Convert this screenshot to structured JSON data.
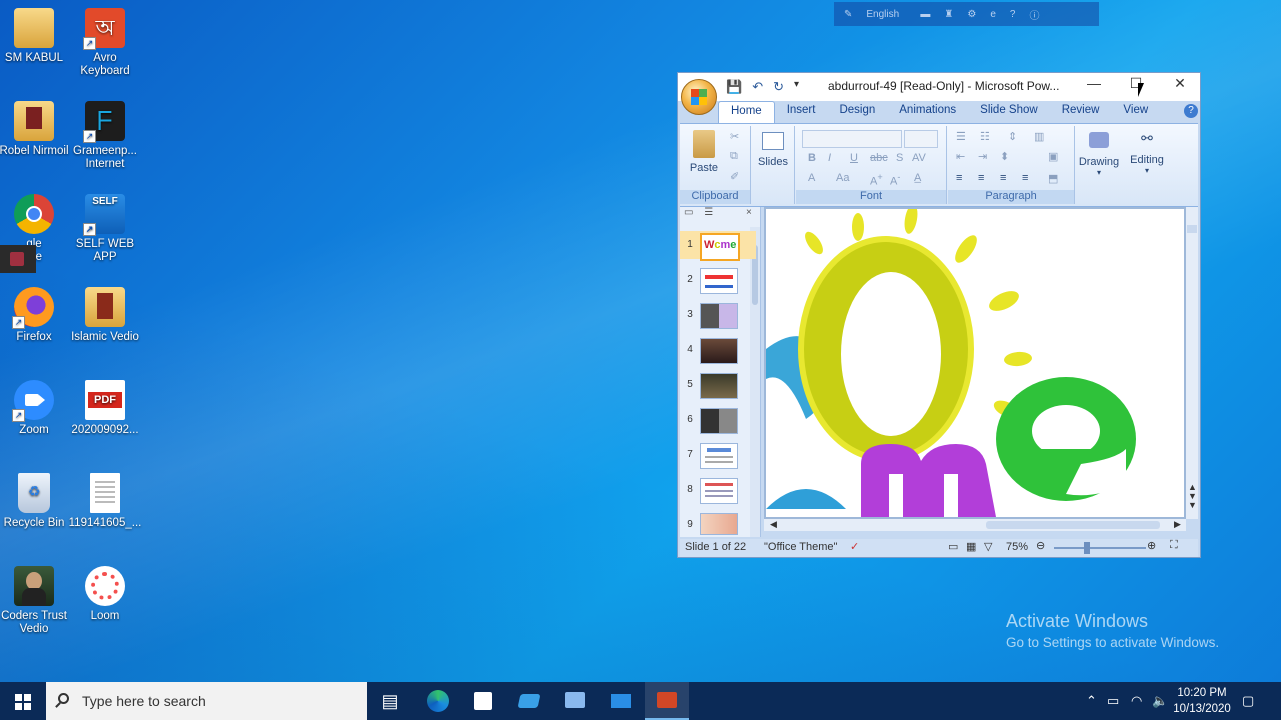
{
  "desktop": {
    "icons": [
      {
        "label": "SM KABUL",
        "icon": "folder-icon"
      },
      {
        "label": "Avro Keyboard",
        "icon": "avro-keyboard-icon"
      },
      {
        "label": "Robel Nirmoil",
        "icon": "folder-icon"
      },
      {
        "label": "Grameenp... Internet",
        "icon": "grameenphone-icon"
      },
      {
        "label": "gle",
        "label2": "me",
        "icon": "chrome-icon"
      },
      {
        "label": "SELF WEB APP",
        "icon": "self-web-app-icon"
      },
      {
        "label": "Firefox",
        "icon": "firefox-icon"
      },
      {
        "label": "Islamic Vedio",
        "icon": "folder-icon"
      },
      {
        "label": "Zoom",
        "icon": "zoom-icon"
      },
      {
        "label": "202009092...",
        "icon": "pdf-icon",
        "badge": "PDF"
      },
      {
        "label": "Recycle Bin",
        "icon": "recycle-bin-icon"
      },
      {
        "label": "119141605_...",
        "icon": "document-icon"
      },
      {
        "label": "Coders Trust Vedio",
        "icon": "video-icon"
      },
      {
        "label": "Loom",
        "icon": "loom-icon"
      }
    ]
  },
  "langbar": {
    "language": "English"
  },
  "powerpoint": {
    "title": "abdurrouf-49 [Read-Only] - Microsoft Pow...",
    "tabs": [
      "Home",
      "Insert",
      "Design",
      "Animations",
      "Slide Show",
      "Review",
      "View"
    ],
    "active_tab": "Home",
    "groups": {
      "clipboard": {
        "label": "Clipboard",
        "paste": "Paste"
      },
      "slides": {
        "label": "Slides"
      },
      "font": {
        "label": "Font"
      },
      "paragraph": {
        "label": "Paragraph"
      },
      "drawing": {
        "label": "Drawing"
      },
      "editing": {
        "label": "Editing"
      }
    },
    "slide_numbers": [
      "1",
      "2",
      "3",
      "4",
      "5",
      "6",
      "7",
      "8",
      "9"
    ],
    "status": {
      "slide": "Slide 1 of 22",
      "theme": "\"Office Theme\"",
      "zoom": "75%"
    }
  },
  "watermark": {
    "line1": "Activate Windows",
    "line2": "Go to Settings to activate Windows."
  },
  "taskbar": {
    "search_placeholder": "Type here to search",
    "time": "10:20 PM",
    "date": "10/13/2020"
  },
  "colors": {
    "taskbar": "#0b2a57",
    "desktop_accent": "#1285e0",
    "office_blue": "#15428b"
  }
}
